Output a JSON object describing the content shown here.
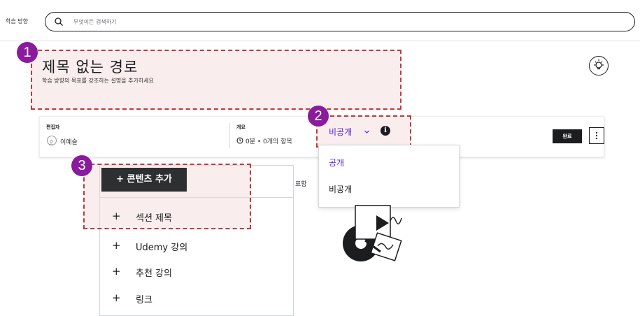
{
  "header": {
    "brand": "학습 방향",
    "search_placeholder": "무엇이든 검색하기"
  },
  "path": {
    "title": "제목 없는 경로",
    "description": "학습 방향의 목표를 강조하는 설명을 추가하세요"
  },
  "info": {
    "editor_label": "편집자",
    "editor_name": "이예슬",
    "overview_label": "개요",
    "overview_value": "0분 • 0개의 항목",
    "visibility_value": "비공개",
    "done_label": "완료"
  },
  "visibility_menu": {
    "options": [
      "공개",
      "비공개"
    ]
  },
  "add_content": {
    "button_label": "+ 콘텐츠 추가",
    "items": [
      "섹션 제목",
      "Udemy 강의",
      "추천 강의",
      "링크"
    ]
  },
  "partial_text": "표함",
  "markers": [
    "1",
    "2",
    "3"
  ],
  "colors": {
    "accent_purple": "#5624d0",
    "marker": "#8a1b9c",
    "annotation": "#c0393b",
    "dark": "#1c1d1f"
  }
}
